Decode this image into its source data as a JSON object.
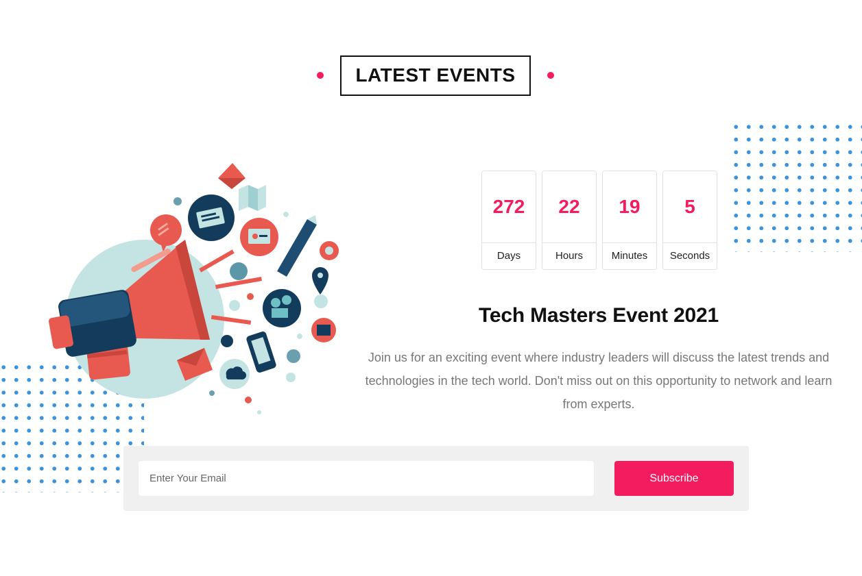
{
  "colors": {
    "accent": "#f21c5f",
    "dot": "#3a93dc"
  },
  "section": {
    "title": "LATEST EVENTS"
  },
  "countdown": [
    {
      "value": "272",
      "label": "Days"
    },
    {
      "value": "22",
      "label": "Hours"
    },
    {
      "value": "19",
      "label": "Minutes"
    },
    {
      "value": "5",
      "label": "Seconds"
    }
  ],
  "event": {
    "title": "Tech Masters Event 2021",
    "description": "Join us for an exciting event where industry leaders will discuss the latest trends and technologies in the tech world. Don't miss out on this opportunity to network and learn from experts."
  },
  "subscribe": {
    "email_placeholder": "Enter Your Email",
    "email_value": "",
    "button_label": "Subscribe"
  },
  "illustration": {
    "icon": "megaphone-icon"
  }
}
